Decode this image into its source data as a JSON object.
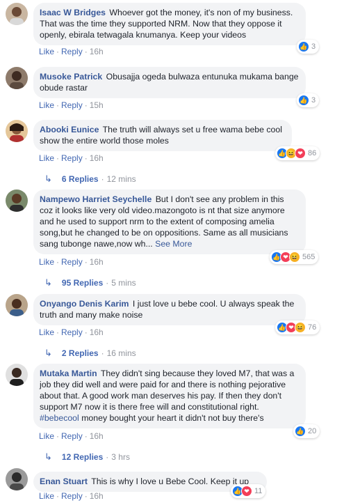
{
  "colors": {
    "link": "#385898",
    "bubble": "#f2f3f5",
    "meta": "#90949c",
    "like": "#1877f2",
    "love": "#f33e58",
    "haha": "#f7b125"
  },
  "labels": {
    "like": "Like",
    "reply": "Reply",
    "dot": "·"
  },
  "comments": [
    {
      "author": "Isaac W Bridges",
      "text": "Whoever got the money, it's non of my business. That was the time they supported NRM. Now that they oppose it openly, ebirala tetwagala knumanya. Keep your videos",
      "time": "16h",
      "reaction_count": "3",
      "reaction_icons": [
        "like-icon"
      ]
    },
    {
      "author": "Musoke Patrick",
      "text": "Obusajja ogeda bulwaza entunuka mukama bange obude rastar",
      "time": "15h",
      "reaction_count": "3",
      "reaction_icons": [
        "like-icon"
      ]
    },
    {
      "author": "Abooki Eunice",
      "text": "The truth will always set u free wama bebe cool show the entire world those moles",
      "time": "16h",
      "reaction_count": "86",
      "reaction_icons": [
        "like-icon",
        "haha-icon",
        "love-icon"
      ],
      "replies": {
        "count": "6 Replies",
        "time": "12 mins"
      }
    },
    {
      "author": "Nampewo Harriet Seychelle",
      "text": "But I don't see any problem in this coz it looks like very old video.mazongoto is nt that size anymore and he used to support nrm to the extent of composing amelia song,but he changed to be on oppositions. Same as all musicians sang tubonge nawe,now wh...",
      "see_more": "See More",
      "time": "16h",
      "reaction_count": "565",
      "reaction_icons": [
        "like-icon",
        "love-icon",
        "haha-icon"
      ],
      "replies": {
        "count": "95 Replies",
        "time": "5 mins"
      }
    },
    {
      "author": "Onyango Denis Karim",
      "text": "I just love u bebe cool. U always speak the truth and many make noise",
      "time": "16h",
      "reaction_count": "76",
      "reaction_icons": [
        "like-icon",
        "love-icon",
        "haha-icon"
      ],
      "replies": {
        "count": "2 Replies",
        "time": "16 mins"
      }
    },
    {
      "author": "Mutaka Martin",
      "text": "They didn't sing because they loved M7, that was a job they did well and were paid for and there is nothing pejorative about that. A good work man deserves his pay. If then they don't support M7 now it is there free will and constitutional right.",
      "hashtag": "#bebecool",
      "text_after": "money bought your heart it didn't not buy there's",
      "time": "16h",
      "reaction_count": "20",
      "reaction_icons": [
        "like-icon"
      ],
      "replies": {
        "count": "12 Replies",
        "time": "3 hrs"
      }
    },
    {
      "author": "Enan Stuart",
      "text": "This is why I love u Bebe Cool. Keep it up",
      "time": "16h",
      "reaction_count": "11",
      "reaction_icons": [
        "like-icon",
        "love-icon"
      ]
    }
  ]
}
